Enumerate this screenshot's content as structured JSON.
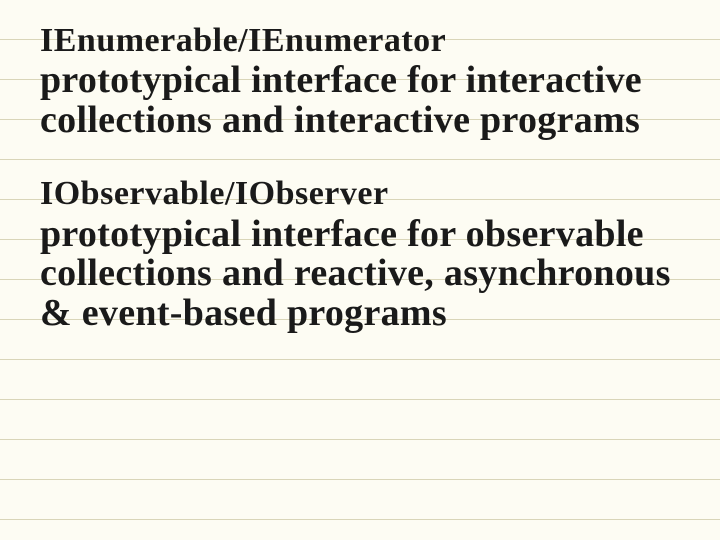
{
  "blocks": [
    {
      "heading": "IEnumerable/IEnumerator",
      "body": "prototypical interface for interactive collections and interactive programs"
    },
    {
      "heading": "IObservable/IObserver",
      "body": "prototypical interface for observable collections and reactive, asynchronous & event-based programs"
    }
  ]
}
